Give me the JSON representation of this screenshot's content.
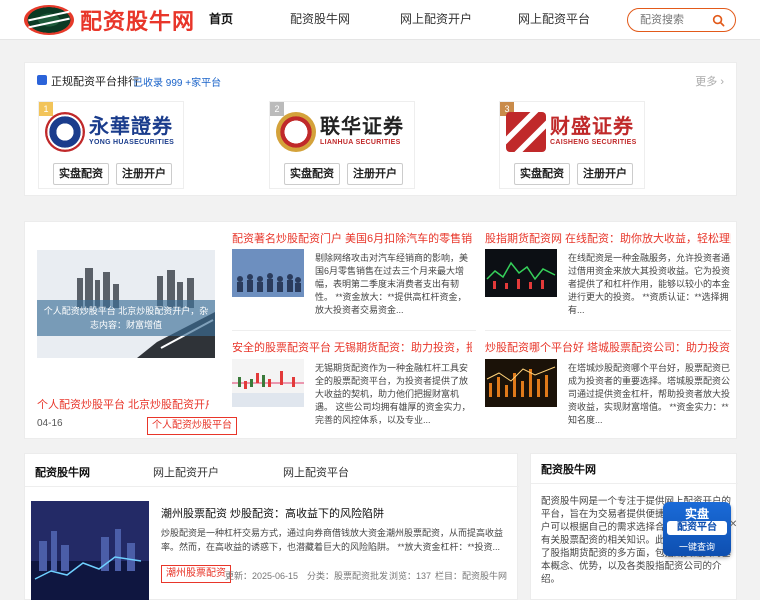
{
  "header": {
    "logo_text": "配资股牛网",
    "nav": [
      {
        "label": "首页"
      },
      {
        "label": "配资股牛网"
      },
      {
        "label": "网上配资开户"
      },
      {
        "label": "网上配资平台"
      }
    ],
    "search_placeholder": "配资搜索"
  },
  "ranking": {
    "title": "正规配资平台排行",
    "subtitle": "已收录 999 +家平台",
    "more": "更多",
    "platforms": [
      {
        "rank": "1",
        "name_cn": "永華證券",
        "name_en": "YONG HUASECURITIES",
        "color": "#1a3c8c",
        "btn1": "实盘配资",
        "btn2": "注册开户"
      },
      {
        "rank": "2",
        "name_cn": "联华证券",
        "name_en": "LIANHUA SECURITIES",
        "color": "#c0292a",
        "btn1": "实盘配资",
        "btn2": "注册开户"
      },
      {
        "rank": "3",
        "name_cn": "财盛证券",
        "name_en": "CAISHENG SECURITIES",
        "color": "#c0292a",
        "btn1": "实盘配资",
        "btn2": "注册开户"
      }
    ]
  },
  "news": {
    "hero_caption": "个人配资炒股平台 北京炒股配资开户，杂志内容：财富增值",
    "hero_link": "个人配资炒股平台 北京炒股配资开户...",
    "hero_date": "04-16",
    "hero_tag": "个人配资炒股平台",
    "articles": [
      {
        "title": "配资著名炒股配资门户 美国6月扣除汽车的零售销售...",
        "text": "剔除网络攻击对汽车经销商的影响，美国6月零售销售在过去三个月来最大增幅，表明第二季度末消费者支出有韧性。 **资金放大：**提供高杠杆资金，放大投资者交易资金..."
      },
      {
        "title": "股指期货配资网 在线配资：助你放大收益，轻松理财",
        "text": "在线配资是一种金融服务，允许投资者通过借用资金来放大其投资收益。它为投资者提供了和杠杆作用，能够以较小的本金进行更大的投资。 **资质认证：**选择拥有..."
      },
      {
        "title": "安全的股票配资平台 无锡期货配资：助力投资，把握...",
        "text": "无锡期货配资作为一种金融杠杆工具安全的股票配资平台，为投资者提供了放大收益的契机，助力他们把握财富机遇。 这些公司均拥有雄厚的资金实力，完善的风控体系，以及专业..."
      },
      {
        "title": "炒股配资哪个平台好 塔城股票配资公司：助力投资，...",
        "text": "在塔城炒股配资哪个平台好，股票配资已成为投资者的重要选择。塔城股票配资公司通过提供资金杠杆，帮助投资者放大投资收益，实现财富增值。 **资金实力：**知名度..."
      }
    ]
  },
  "bottom_left": {
    "tabs": [
      {
        "label": "配资股牛网"
      },
      {
        "label": "网上配资开户"
      },
      {
        "label": "网上配资平台"
      }
    ],
    "title": "潮州股票配资 炒股配资：高收益下的风险陷阱",
    "text": "炒股配资是一种杠杆交易方式，通过向券商借钱放大资金潮州股票配资，从而提高收益率。然而，在高收益的诱惑下，也潜藏着巨大的风险陷阱。 **放大资金杠杆：**投资...",
    "tag": "潮州股票配资",
    "updated": "更新：2025-06-15",
    "category": "分类：股票配资批发",
    "views": "浏览：137",
    "column": "栏目：配资股牛网"
  },
  "bottom_right": {
    "title": "配资股牛网",
    "text": "配资股牛网是一个专注于提供网上配资开户的平台，旨在为交易者提供便捷的配资服务。用户可以根据自己的需求选择合适的平台，了解有关股票配资的相关知识。此外，本站也涵盖了股指期货配资的多方面，包括期货配资的基本概念、优势，以及各类股指配资公司的介绍。"
  },
  "float_widget": {
    "line1": "实盘",
    "line2": "配资平台",
    "line3": "一键查询",
    "close": "✕"
  }
}
